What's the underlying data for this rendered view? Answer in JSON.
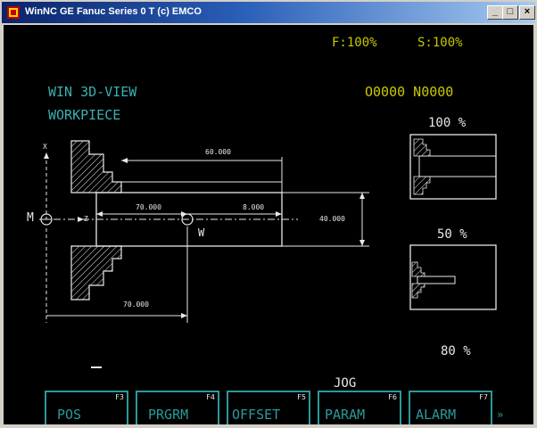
{
  "window": {
    "title": "WinNC GE Fanuc Series 0 T (c) EMCO",
    "buttons": {
      "minimize": "_",
      "maximize": "□",
      "close": "×"
    }
  },
  "status": {
    "feed_override": "F:100%",
    "spindle_override": "S:100%",
    "program": "O0000 N0000",
    "mode": "JOG"
  },
  "view": {
    "heading1": "WIN 3D-VIEW",
    "heading2": "WORKPIECE"
  },
  "drawing": {
    "dim_top": "60.000",
    "dim_mid_left": "70.000",
    "dim_mid_right": "8.000",
    "dim_diameter": "40.000",
    "dim_bottom": "70.000",
    "machine_zero": "M",
    "workpiece_zero": "W",
    "axis_x": "X",
    "axis_z": "Z"
  },
  "zoom": {
    "top": "100 %",
    "middle": "50 %",
    "bottom": "80 %"
  },
  "softkeys": [
    {
      "fkey": "F3",
      "label": "POS"
    },
    {
      "fkey": "F4",
      "label": "PRGRM"
    },
    {
      "fkey": "F5",
      "label": "OFFSET"
    },
    {
      "fkey": "F6",
      "label": "PARAM"
    },
    {
      "fkey": "F7",
      "label": "ALARM"
    }
  ],
  "more_arrow": "»",
  "colors": {
    "screen_bg": "#000000",
    "status_yellow": "#c8c800",
    "heading_cyan": "#3ab0b0",
    "drawing_white": "#e8e8e8",
    "title_blue": "#0a246a"
  }
}
